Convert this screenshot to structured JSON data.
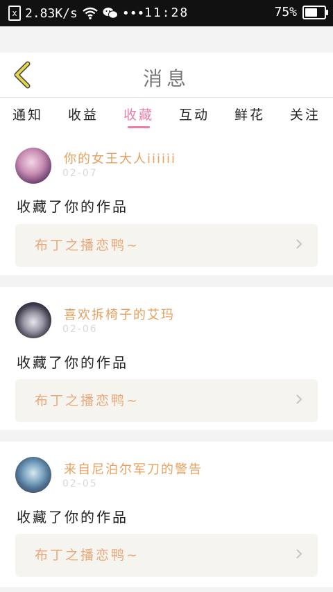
{
  "status_bar": {
    "sim": "x",
    "speed": "2.83K/s",
    "dots": "•••",
    "time": "11:28",
    "battery_text": "75%",
    "battery_level": 0.75
  },
  "header": {
    "title": "消息"
  },
  "tabs": [
    {
      "label": "通知"
    },
    {
      "label": "收益"
    },
    {
      "label": "收藏",
      "active": true
    },
    {
      "label": "互动"
    },
    {
      "label": "鲜花"
    },
    {
      "label": "关注"
    }
  ],
  "items": [
    {
      "username": "你的女王大人iiiiii",
      "date": "02-07",
      "action": "收藏了你的作品",
      "work": "布丁之播恋鸭~"
    },
    {
      "username": "喜欢拆椅子的艾玛",
      "date": "02-06",
      "action": "收藏了你的作品",
      "work": "布丁之播恋鸭~"
    },
    {
      "username": "来自尼泊尔军刀的警告",
      "date": "02-05",
      "action": "收藏了你的作品",
      "work": "布丁之播恋鸭~"
    }
  ],
  "colors": {
    "accent": "#e97fa8",
    "username": "#e8a05f",
    "back_icon": "#e4d84a"
  }
}
